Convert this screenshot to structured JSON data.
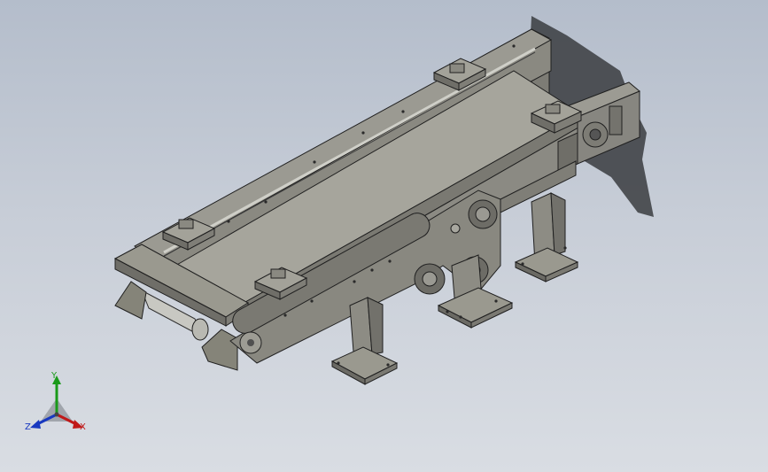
{
  "viewport": {
    "background_top": "#b4bdcb",
    "background_bottom": "#d9dde3"
  },
  "model": {
    "part_color": "#8f8e86",
    "part_shadow_color": "#5c5b56",
    "edge_color": "#202020",
    "belt_color": "#a6a59c",
    "cast_shadow_color": "#3a3c40"
  },
  "triad": {
    "axes": {
      "y": {
        "label": "Y",
        "color": "#1a9a1a"
      },
      "x": {
        "label": "X",
        "color": "#c01818"
      },
      "z": {
        "label": "Z",
        "color": "#1838c0"
      }
    }
  }
}
